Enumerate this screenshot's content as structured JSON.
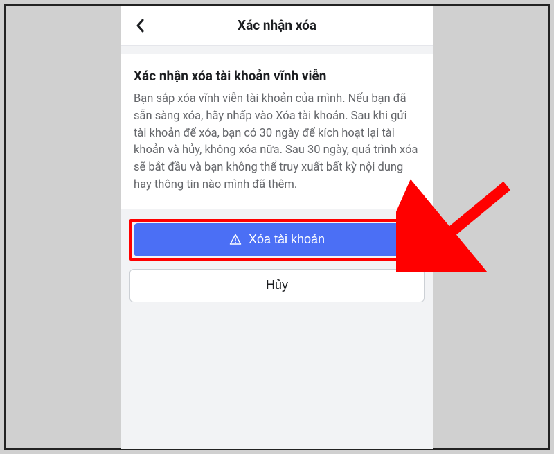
{
  "header": {
    "title": "Xác nhận xóa"
  },
  "card": {
    "title": "Xác nhận xóa tài khoản vĩnh viễn",
    "body": "Bạn sắp xóa vĩnh viễn tài khoản của mình. Nếu bạn đã sẵn sàng xóa, hãy nhấp vào Xóa tài khoản. Sau khi gửi tài khoản để xóa, bạn có 30 ngày để kích hoạt lại tài khoản và hủy, không xóa nữa. Sau 30 ngày, quá trình xóa sẽ bắt đầu và bạn không thể truy xuất bất kỳ nội dung hay thông tin nào mình đã thêm."
  },
  "buttons": {
    "delete": "Xóa tài khoản",
    "cancel": "Hủy"
  },
  "colors": {
    "primary": "#4b6ff5",
    "highlight": "#ff0000",
    "arrow": "#ff0000"
  }
}
